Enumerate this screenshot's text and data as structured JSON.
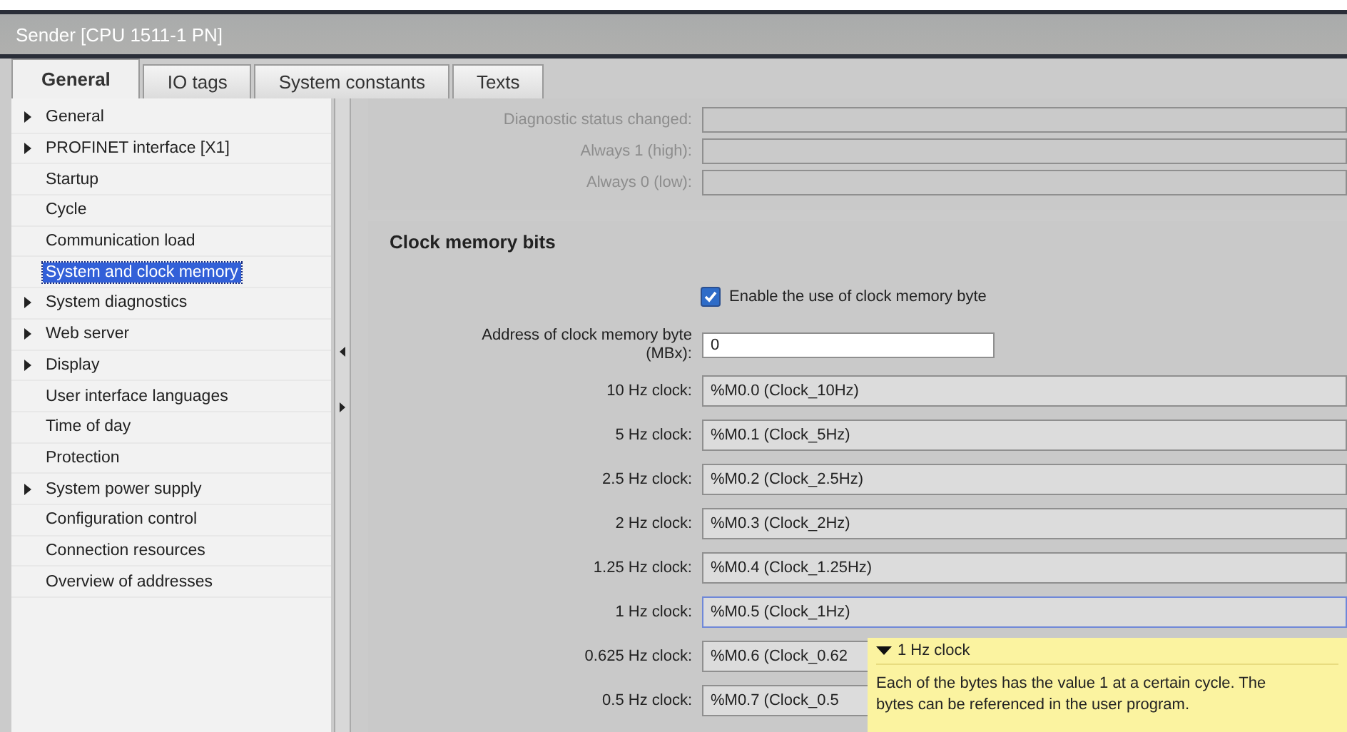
{
  "window": {
    "title": "Sender [CPU 1511-1 PN]"
  },
  "tabs": [
    {
      "label": "General",
      "selected": true
    },
    {
      "label": "IO tags",
      "selected": false
    },
    {
      "label": "System constants",
      "selected": false
    },
    {
      "label": "Texts",
      "selected": false
    }
  ],
  "sidebar": {
    "items": [
      {
        "label": "General",
        "expandable": true,
        "selected": false
      },
      {
        "label": "PROFINET interface [X1]",
        "expandable": true,
        "selected": false
      },
      {
        "label": "Startup",
        "expandable": false,
        "selected": false
      },
      {
        "label": "Cycle",
        "expandable": false,
        "selected": false
      },
      {
        "label": "Communication load",
        "expandable": false,
        "selected": false
      },
      {
        "label": "System and clock memory",
        "expandable": false,
        "selected": true
      },
      {
        "label": "System diagnostics",
        "expandable": true,
        "selected": false
      },
      {
        "label": "Web server",
        "expandable": true,
        "selected": false
      },
      {
        "label": "Display",
        "expandable": true,
        "selected": false
      },
      {
        "label": "User interface languages",
        "expandable": false,
        "selected": false
      },
      {
        "label": "Time of day",
        "expandable": false,
        "selected": false
      },
      {
        "label": "Protection",
        "expandable": false,
        "selected": false
      },
      {
        "label": "System power supply",
        "expandable": true,
        "selected": false
      },
      {
        "label": "Configuration control",
        "expandable": false,
        "selected": false
      },
      {
        "label": "Connection resources",
        "expandable": false,
        "selected": false
      },
      {
        "label": "Overview of addresses",
        "expandable": false,
        "selected": false
      }
    ]
  },
  "system_memory": {
    "fields": [
      {
        "label": "Diagnostic status changed:",
        "disabled": true
      },
      {
        "label": "Always 1 (high):",
        "disabled": true
      },
      {
        "label": "Always 0 (low):",
        "disabled": true
      }
    ]
  },
  "clock_memory": {
    "title": "Clock memory bits",
    "enable": {
      "label": "Enable the use of clock memory byte",
      "checked": true
    },
    "address": {
      "label_line_1": "Address of clock memory byte",
      "label_line_2": "(MBx):",
      "value": "0"
    },
    "clocks": [
      {
        "label": "10 Hz clock:",
        "value": "%M0.0 (Clock_10Hz)",
        "focused": false
      },
      {
        "label": "5 Hz clock:",
        "value": "%M0.1 (Clock_5Hz)",
        "focused": false
      },
      {
        "label": "2.5 Hz clock:",
        "value": "%M0.2 (Clock_2.5Hz)",
        "focused": false
      },
      {
        "label": "2 Hz clock:",
        "value": "%M0.3 (Clock_2Hz)",
        "focused": false
      },
      {
        "label": "1.25 Hz clock:",
        "value": "%M0.4 (Clock_1.25Hz)",
        "focused": false
      },
      {
        "label": "1 Hz clock:",
        "value": "%M0.5 (Clock_1Hz)",
        "focused": true
      },
      {
        "label": "0.625 Hz clock:",
        "value": "%M0.6 (Clock_0.62",
        "focused": false
      },
      {
        "label": "0.5 Hz clock:",
        "value": "%M0.7 (Clock_0.5",
        "focused": false
      }
    ]
  },
  "tooltip": {
    "title": "1 Hz clock",
    "text": "Each of the bytes has the value 1 at a certain cycle. The bytes can be referenced in the user program."
  }
}
